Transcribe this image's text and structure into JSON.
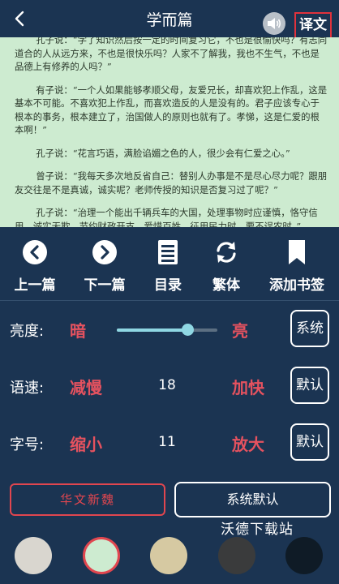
{
  "header": {
    "title": "学而篇",
    "translate_label": "译文"
  },
  "reader": {
    "paragraphs": [
      "孔子说：“学了知识然后按一定的时间复习它，不也是很愉快吗？有志同道合的人从远方来，不也是很快乐吗？人家不了解我，我也不生气，不也是品德上有修养的人吗？”",
      "有子说：“一个人如果能够孝顺父母，友爱兄长，却喜欢犯上作乱，这是基本不可能。不喜欢犯上作乱，而喜欢造反的人是没有的。君子应该专心于根本的事务，根本建立了，治国做人的原则也就有了。孝悌，这是仁爱的根本啊！”",
      "孔子说：“花言巧语，满脸谄媚之色的人，很少会有仁爱之心。”",
      "曾子说：“我每天多次地反省自己：替别人办事是不是尽心尽力呢？跟朋友交往是不是真诚，诚实呢？老师传授的知识是否复习过了呢？”",
      "孔子说：“治理一个能出千辆兵车的大国，处理事物时应谨慎，恪守信用，诚实无欺，节约财政开支，爱惜百姓，征用民力时，要不误农时。”"
    ]
  },
  "nav": {
    "items": [
      {
        "label": "上一篇",
        "icon": "chevron-left-circle-icon"
      },
      {
        "label": "下一篇",
        "icon": "chevron-right-circle-icon"
      },
      {
        "label": "目录",
        "icon": "list-document-icon"
      },
      {
        "label": "繁体",
        "icon": "refresh-icon"
      },
      {
        "label": "添加书签",
        "icon": "bookmark-icon"
      }
    ]
  },
  "settings": {
    "brightness": {
      "label": "亮度:",
      "dark": "暗",
      "bright": "亮",
      "system": "系统",
      "level": 0.7
    },
    "speed": {
      "label": "语速:",
      "slower": "减慢",
      "value": "18",
      "faster": "加快",
      "default": "默认"
    },
    "font_size": {
      "label": "字号:",
      "smaller": "缩小",
      "value": "11",
      "larger": "放大",
      "default": "默认"
    }
  },
  "font": {
    "current": "华文新魏",
    "system_default": "系统默认"
  },
  "watermark": "沃德下载站",
  "themes": [
    "#d9d6cf",
    "#cdebd0",
    "#d6c9a2",
    "#3a3b3c",
    "#0f1b26"
  ],
  "colors": {
    "accent": "#e5525f",
    "background": "#1b3452",
    "slider": "#8fd7e3"
  }
}
